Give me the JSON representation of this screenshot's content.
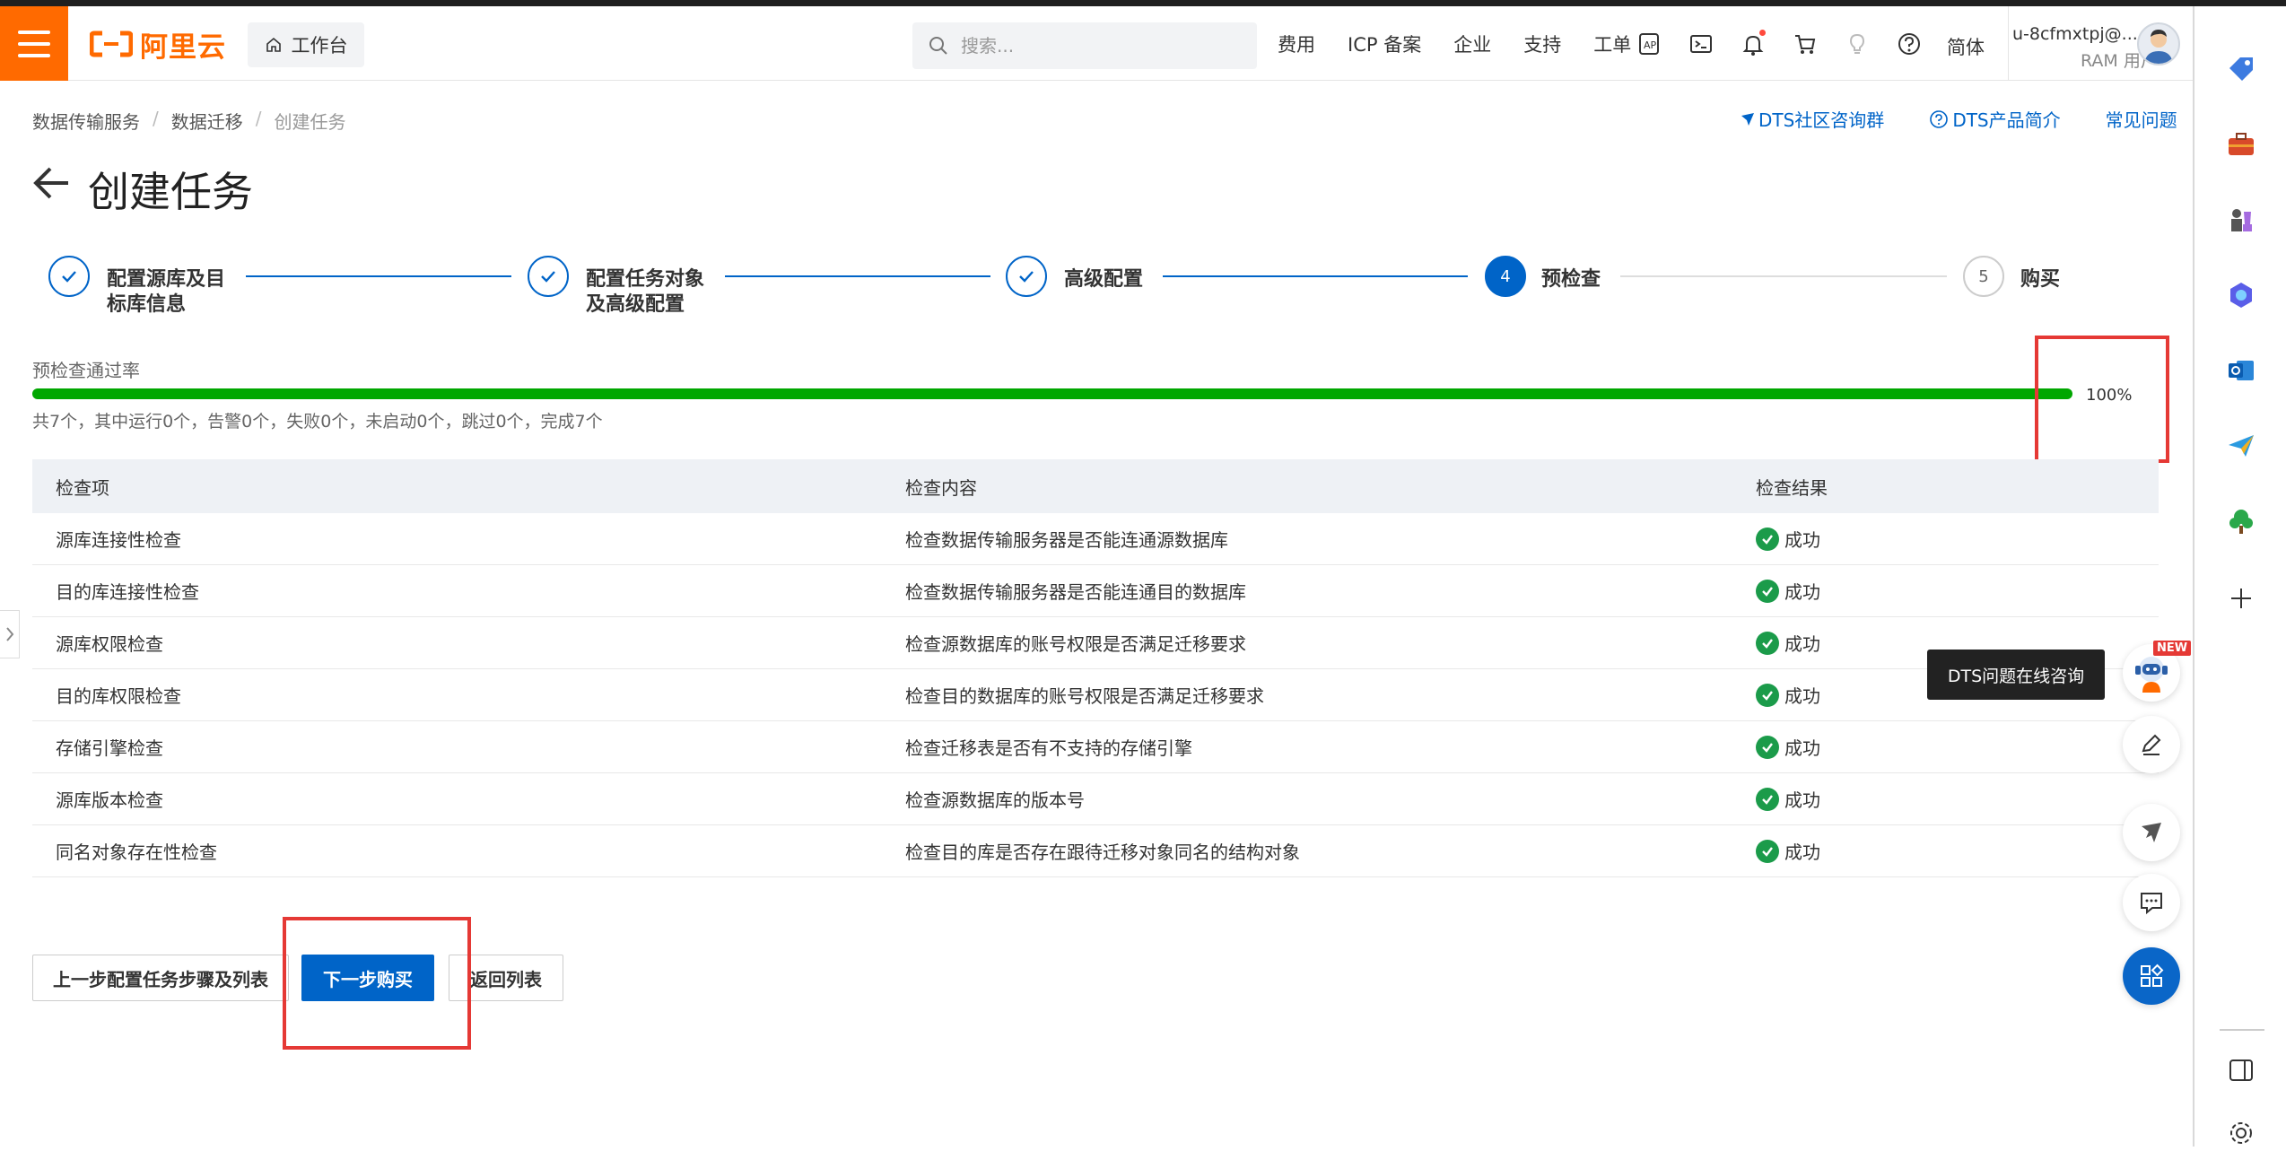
{
  "header": {
    "logo_text": "阿里云",
    "workbench": "工作台",
    "search_placeholder": "搜索...",
    "links": [
      "费用",
      "ICP 备案",
      "企业",
      "支持",
      "工单"
    ],
    "lang": "简体",
    "user_name": "u-8cfmxtpj@...",
    "user_role": "RAM 用户",
    "accent_color": "#ff6a00"
  },
  "breadcrumb": {
    "items": [
      "数据传输服务",
      "数据迁移",
      "创建任务"
    ]
  },
  "top_links": {
    "community": "DTS社区咨询群",
    "product": "DTS产品简介",
    "faq": "常见问题"
  },
  "page": {
    "title": "创建任务"
  },
  "steps": [
    {
      "label_line1": "配置源库及目",
      "label_line2": "标库信息",
      "state": "done"
    },
    {
      "label_line1": "配置任务对象",
      "label_line2": "及高级配置",
      "state": "done"
    },
    {
      "label_line1": "高级配置",
      "label_line2": "",
      "state": "done"
    },
    {
      "label_line1": "预检查",
      "label_line2": "",
      "state": "active",
      "num": "4"
    },
    {
      "label_line1": "购买",
      "label_line2": "",
      "state": "todo",
      "num": "5"
    }
  ],
  "precheck": {
    "title": "预检查通过率",
    "percent_text": "100%",
    "percent": 1.0,
    "summary": "共7个，其中运行0个，告警0个，失败0个，未启动0个，跳过0个，完成7个",
    "bar_color": "#00a700"
  },
  "table": {
    "headers": [
      "检查项",
      "检查内容",
      "检查结果"
    ],
    "rows": [
      {
        "item": "源库连接性检查",
        "content": "检查数据传输服务器是否能连通源数据库",
        "result": "成功"
      },
      {
        "item": "目的库连接性检查",
        "content": "检查数据传输服务器是否能连通目的数据库",
        "result": "成功"
      },
      {
        "item": "源库权限检查",
        "content": "检查源数据库的账号权限是否满足迁移要求",
        "result": "成功"
      },
      {
        "item": "目的库权限检查",
        "content": "检查目的数据库的账号权限是否满足迁移要求",
        "result": "成功"
      },
      {
        "item": "存储引擎检查",
        "content": "检查迁移表是否有不支持的存储引擎",
        "result": "成功"
      },
      {
        "item": "源库版本检查",
        "content": "检查源数据库的版本号",
        "result": "成功"
      },
      {
        "item": "同名对象存在性检查",
        "content": "检查目的库是否存在跟待迁移对象同名的结构对象",
        "result": "成功"
      }
    ]
  },
  "actions": {
    "prev": "上一步配置任务步骤及列表",
    "next": "下一步购买",
    "back": "返回列表"
  },
  "floating": {
    "tooltip": "DTS问题在线咨询",
    "new_tag": "NEW"
  },
  "colors": {
    "primary": "#0064c8",
    "success": "#1b9b4a",
    "highlight": "#e53935"
  }
}
